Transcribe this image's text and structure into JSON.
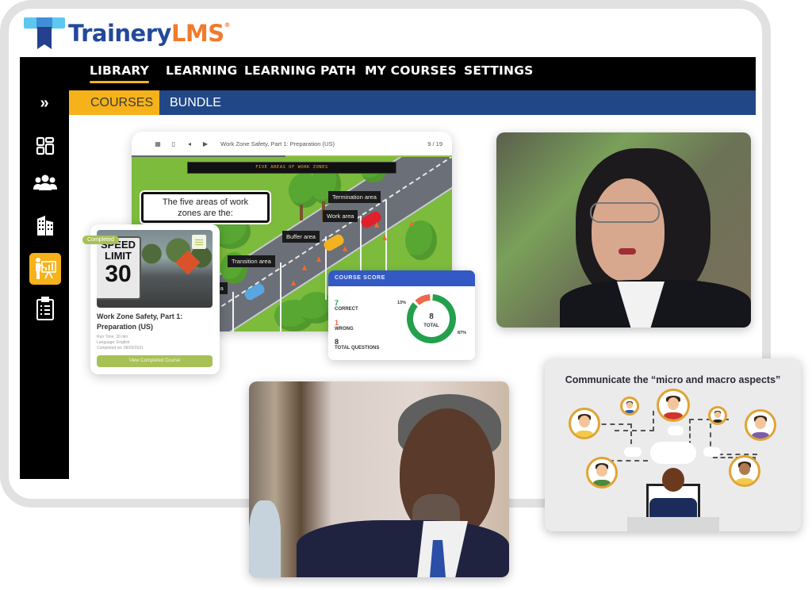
{
  "brand": {
    "name_part1": "Trainery",
    "name_part2": "LMS",
    "registered": "®"
  },
  "topnav": {
    "items": [
      {
        "label": "LIBRARY",
        "active": true
      },
      {
        "label": "LEARNING",
        "active": false
      },
      {
        "label": "LEARNING PATH",
        "active": false
      },
      {
        "label": "MY COURSES",
        "active": false
      },
      {
        "label": "SETTINGS",
        "active": false
      }
    ]
  },
  "subnav": {
    "tabs": [
      {
        "label": "COURSES",
        "active": true
      },
      {
        "label": "BUNDLE",
        "active": false
      }
    ]
  },
  "sidebar": {
    "expand_glyph": "»",
    "items": [
      {
        "icon": "dashboard-icon",
        "active": false
      },
      {
        "icon": "users-icon",
        "active": false
      },
      {
        "icon": "building-icon",
        "active": false
      },
      {
        "icon": "presentation-icon",
        "active": true
      },
      {
        "icon": "clipboard-icon",
        "active": false
      }
    ]
  },
  "player": {
    "title": "Work Zone Safety, Part 1: Preparation (US)",
    "pages": "9 / 19",
    "banner": "FIVE AREAS OF WORK ZONES",
    "intro_line1": "The five areas of work",
    "intro_line2": "zones are the:",
    "labels": {
      "termination": "Termination area",
      "work": "Work area",
      "buffer": "Buffer area",
      "transition": "Transition area",
      "advance": "rea"
    }
  },
  "course_card": {
    "badge": "Completed",
    "sign_line1": "SPEED",
    "sign_line2": "LIMIT",
    "sign_line3": "30",
    "title": "Work Zone Safety, Part 1: Preparation (US)",
    "run_time": "Run Time: 30 min",
    "language": "Language: English",
    "completed_on": "Completed on: 08/26/2021",
    "button": "View Completed Course"
  },
  "score_card": {
    "title": "COURSE SCORE",
    "correct_value": "7",
    "correct_label": "CORRECT",
    "wrong_value": "1",
    "wrong_label": "WRONG",
    "total_value": "8",
    "total_label": "TOTAL QUESTIONS",
    "donut_total": "8",
    "donut_total_label": "TOTAL",
    "wrong_pct_label": "13%",
    "correct_pct_label": "87%",
    "correct_fraction": 0.875,
    "colors": {
      "correct": "#22a04b",
      "wrong": "#ee6a4a",
      "header": "#3359c4"
    }
  },
  "diagram": {
    "title": "Communicate the “micro and macro aspects”"
  },
  "colors": {
    "accent": "#f6b21b",
    "nav_blue": "#214787",
    "brand_blue": "#24499a",
    "brand_orange": "#f07b2c",
    "completed_green": "#a8c157"
  }
}
